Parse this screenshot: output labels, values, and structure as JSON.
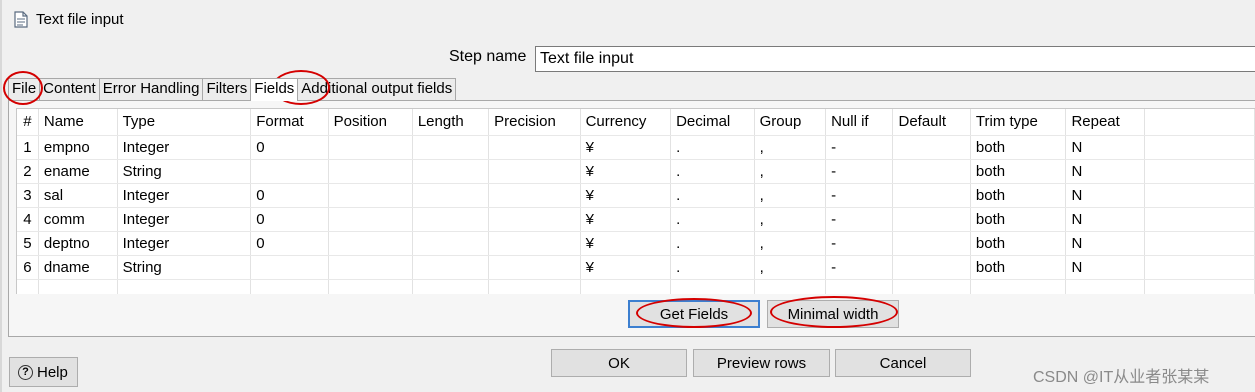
{
  "window": {
    "title": "Text file input",
    "icon": "text-file-icon"
  },
  "step": {
    "label": "Step name",
    "value": "Text file input"
  },
  "tabs": [
    {
      "label": "File"
    },
    {
      "label": "Content"
    },
    {
      "label": "Error Handling"
    },
    {
      "label": "Filters"
    },
    {
      "label": "Fields"
    },
    {
      "label": "Additional output fields"
    }
  ],
  "table": {
    "columns": [
      "#",
      "Name",
      "Type",
      "Format",
      "Position",
      "Length",
      "Precision",
      "Currency",
      "Decimal",
      "Group",
      "Null if",
      "Default",
      "Trim type",
      "Repeat"
    ],
    "rows": [
      [
        "1",
        "empno",
        "Integer",
        "0",
        "",
        "",
        "",
        "¥",
        ".",
        ",",
        "-",
        "",
        "both",
        "N"
      ],
      [
        "2",
        "ename",
        "String",
        "",
        "",
        "",
        "",
        "¥",
        ".",
        ",",
        "-",
        "",
        "both",
        "N"
      ],
      [
        "3",
        "sal",
        "Integer",
        "0",
        "",
        "",
        "",
        "¥",
        ".",
        ",",
        "-",
        "",
        "both",
        "N"
      ],
      [
        "4",
        "comm",
        "Integer",
        "0",
        "",
        "",
        "",
        "¥",
        ".",
        ",",
        "-",
        "",
        "both",
        "N"
      ],
      [
        "5",
        "deptno",
        "Integer",
        "0",
        "",
        "",
        "",
        "¥",
        ".",
        ",",
        "-",
        "",
        "both",
        "N"
      ],
      [
        "6",
        "dname",
        "String",
        "",
        "",
        "",
        "",
        "¥",
        ".",
        ",",
        "-",
        "",
        "both",
        "N"
      ]
    ]
  },
  "buttons": {
    "get_fields": "Get Fields",
    "minimal_width": "Minimal width",
    "ok": "OK",
    "preview_rows": "Preview rows",
    "cancel": "Cancel",
    "help": "Help"
  },
  "watermark": "CSDN @IT从业者张某某",
  "colors": {
    "highlight": "#d40000",
    "focus": "#3c7fd0"
  }
}
